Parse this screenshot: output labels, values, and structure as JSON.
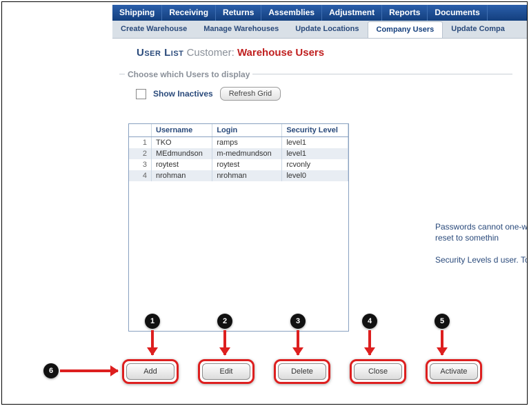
{
  "nav1": [
    "Shipping",
    "Receiving",
    "Returns",
    "Assemblies",
    "Adjustment",
    "Reports",
    "Documents"
  ],
  "nav2": [
    {
      "label": "Create Warehouse",
      "active": false
    },
    {
      "label": "Manage Warehouses",
      "active": false
    },
    {
      "label": "Update Locations",
      "active": false
    },
    {
      "label": "Company Users",
      "active": true
    },
    {
      "label": "Update Compa",
      "active": false
    }
  ],
  "title": {
    "main": "User List",
    "customer_label": "Customer:",
    "customer": "Warehouse Users"
  },
  "panel": {
    "legend": "Choose which Users to display",
    "show_inactives": "Show Inactives",
    "refresh": "Refresh Grid"
  },
  "grid": {
    "headers": [
      "Username",
      "Login",
      "Security Level"
    ],
    "rows": [
      {
        "n": "1",
        "username": "TKO",
        "login": "ramps",
        "level": "level1"
      },
      {
        "n": "2",
        "username": "MEdmundson",
        "login": "m-medmundson",
        "level": "level1"
      },
      {
        "n": "3",
        "username": "roytest",
        "login": "roytest",
        "level": "rcvonly"
      },
      {
        "n": "4",
        "username": "nrohman",
        "login": "nrohman",
        "level": "level0"
      }
    ]
  },
  "side": {
    "p1": "Passwords cannot one-way encrypti reset to somethin",
    "p2": "Security Levels d user. To see deta"
  },
  "actions": [
    "Add",
    "Edit",
    "Delete",
    "Close",
    "Activate"
  ],
  "callouts": [
    "1",
    "2",
    "3",
    "4",
    "5",
    "6"
  ]
}
